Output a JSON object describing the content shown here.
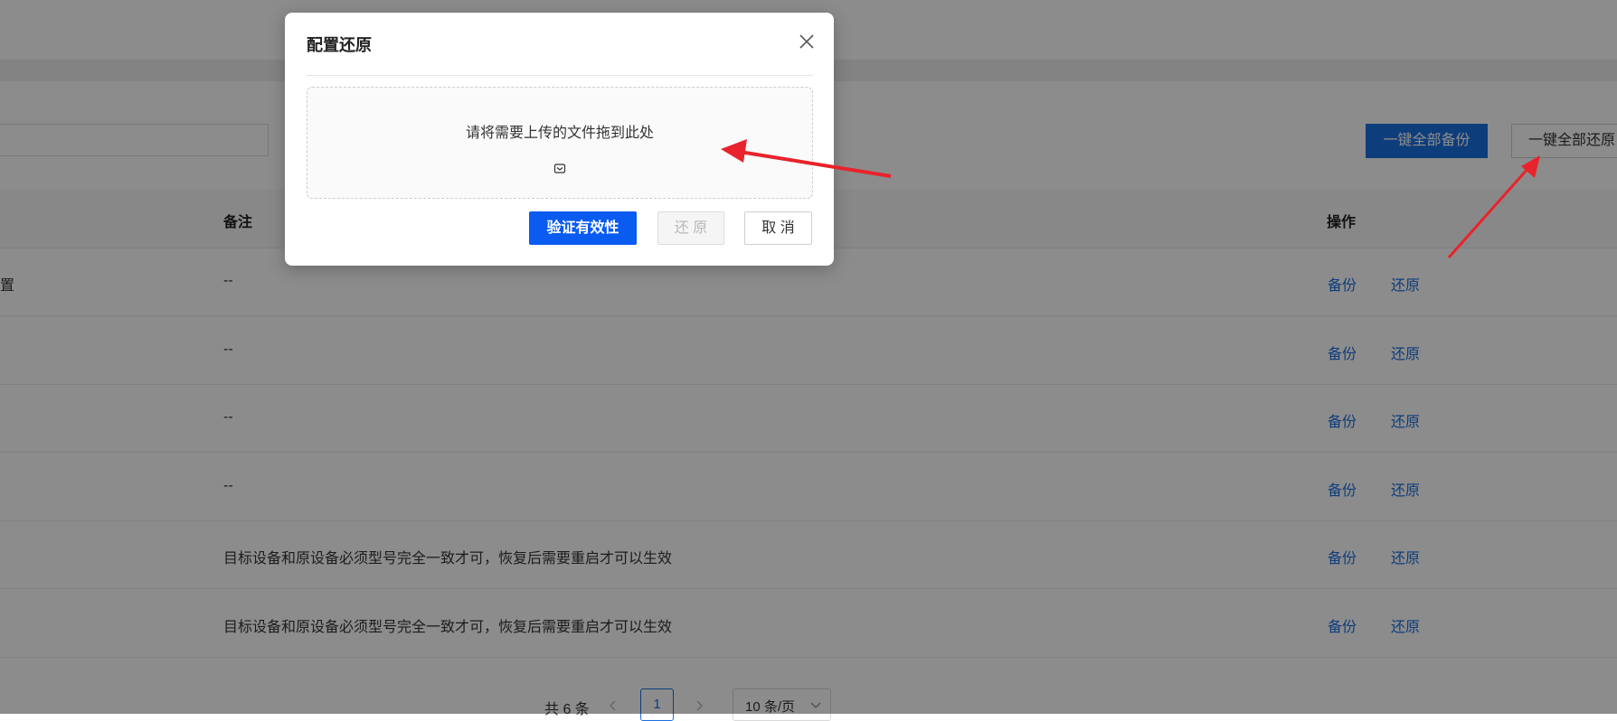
{
  "toolbar": {
    "backup_all_label": "一键全部备份",
    "restore_all_label": "一键全部还原"
  },
  "table": {
    "columns": {
      "note": "备注",
      "actions": "操作"
    },
    "rows": [
      {
        "name": "置",
        "note": "--",
        "backup": "备份",
        "restore": "还原"
      },
      {
        "name": "",
        "note": "--",
        "backup": "备份",
        "restore": "还原"
      },
      {
        "name": "",
        "note": "--",
        "backup": "备份",
        "restore": "还原"
      },
      {
        "name": "",
        "note": "--",
        "backup": "备份",
        "restore": "还原"
      },
      {
        "name": "",
        "note": "目标设备和原设备必须型号完全一致才可，恢复后需要重启才可以生效",
        "backup": "备份",
        "restore": "还原"
      },
      {
        "name": "",
        "note": "目标设备和原设备必须型号完全一致才可，恢复后需要重启才可以生效",
        "backup": "备份",
        "restore": "还原"
      }
    ]
  },
  "pagination": {
    "total": "共 6 条",
    "current_page": "1",
    "page_size": "10 条/页"
  },
  "modal": {
    "title": "配置还原",
    "dropzone_text": "请将需要上传的文件拖到此处",
    "verify_label": "验证有效性",
    "restore_label": "还 原",
    "cancel_label": "取 消"
  },
  "colors": {
    "primary": "#1a6fe0",
    "verify_button": "#0a5bf0",
    "annotation_arrow": "#e8232b"
  },
  "icons": [
    "close-icon",
    "upload-icon",
    "chevron-left-icon",
    "chevron-right-icon",
    "chevron-down-icon"
  ]
}
